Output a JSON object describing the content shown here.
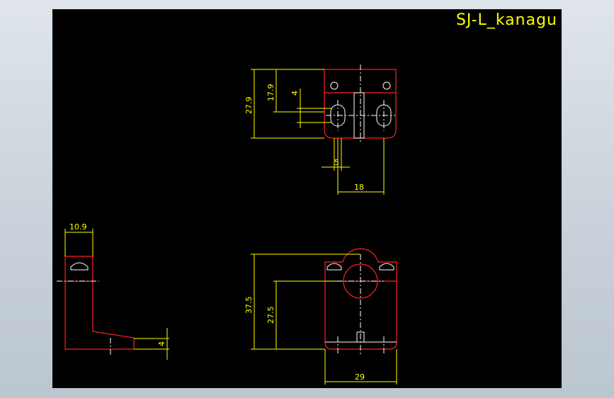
{
  "drawing": {
    "title": "SJ-L_kanagu",
    "colors": {
      "background": "#000000",
      "dimension": "#ffff00",
      "outline": "#ff2020",
      "centerline": "#ffffff"
    },
    "dimensions": {
      "top_height_total": "27.9",
      "top_height_slot": "17.9",
      "top_slot_width": "4",
      "top_slot_gap": "5",
      "top_hole_pitch": "18",
      "side_width": "10.9",
      "side_foot_height": "4",
      "front_height_total": "37.5",
      "front_center_height": "27.5",
      "front_base_width": "29"
    }
  }
}
